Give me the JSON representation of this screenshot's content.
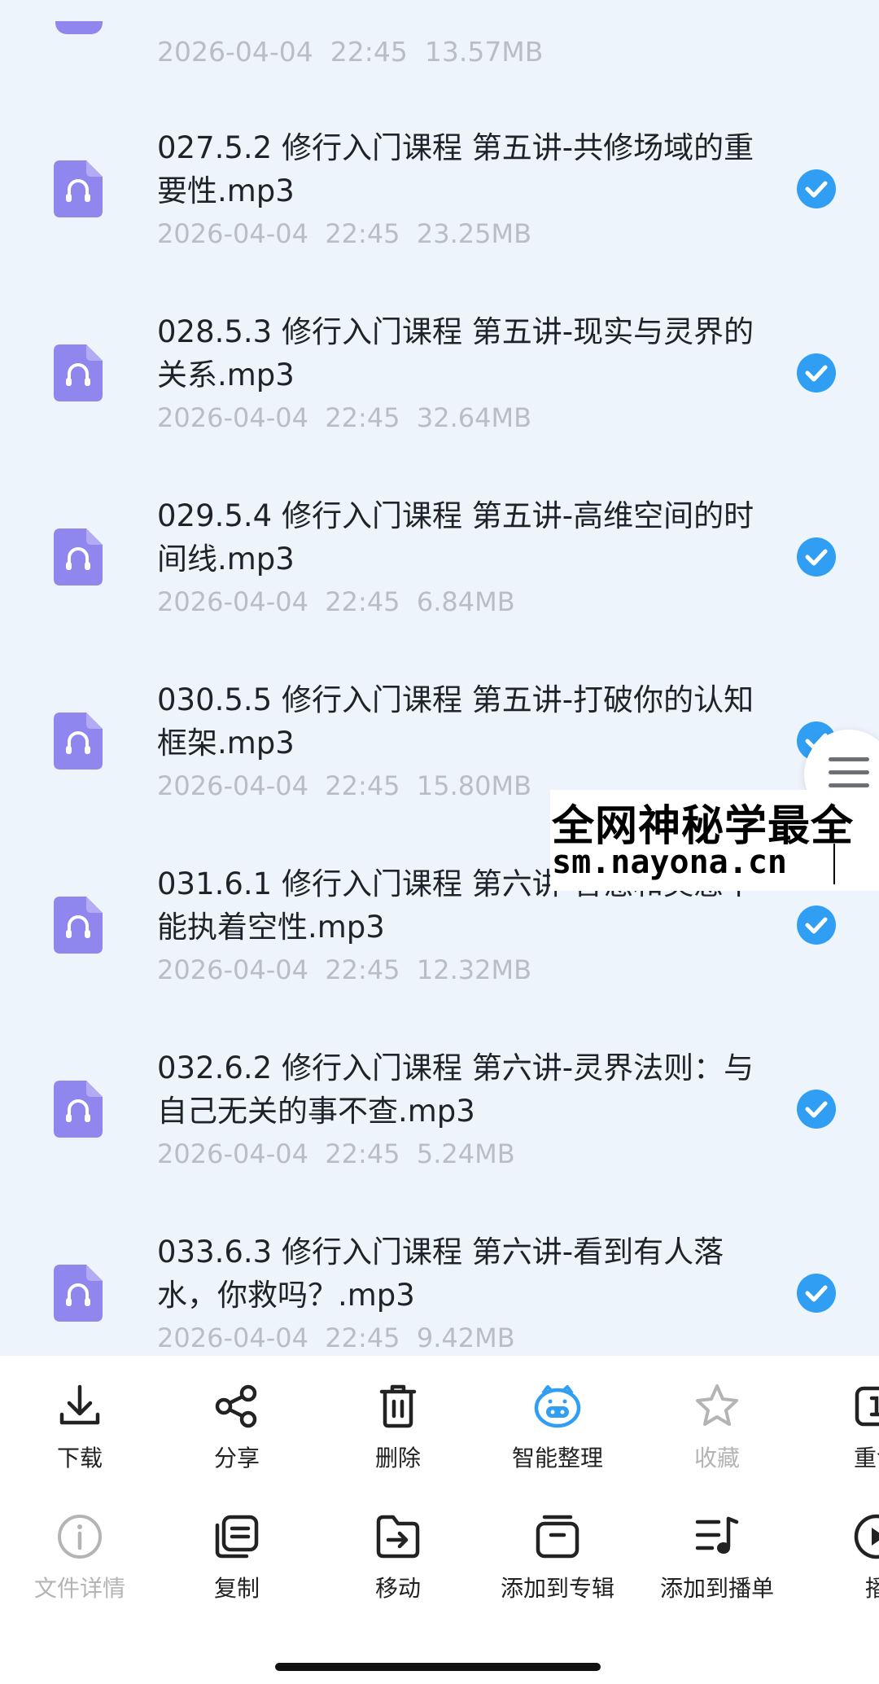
{
  "file_list": {
    "partial_top_meta": "2026-04-04  22:45  13.57MB",
    "items": [
      {
        "title": "027.5.2 修行入门课程 第五讲-共修场域的重要性.mp3",
        "date": "2026-04-04",
        "time": "22:45",
        "size": "23.25MB",
        "selected": true
      },
      {
        "title": "028.5.3 修行入门课程 第五讲-现实与灵界的关系.mp3",
        "date": "2026-04-04",
        "time": "22:45",
        "size": "32.64MB",
        "selected": true
      },
      {
        "title": "029.5.4 修行入门课程 第五讲-高维空间的时间线.mp3",
        "date": "2026-04-04",
        "time": "22:45",
        "size": "6.84MB",
        "selected": true
      },
      {
        "title": "030.5.5 修行入门课程 第五讲-打破你的认知框架.mp3",
        "date": "2026-04-04",
        "time": "22:45",
        "size": "15.80MB",
        "selected": true
      },
      {
        "title": "031.6.1 修行入门课程 第六讲-智慧和灵感不能执着空性.mp3",
        "date": "2026-04-04",
        "time": "22:45",
        "size": "12.32MB",
        "selected": true
      },
      {
        "title": "032.6.2 修行入门课程 第六讲-灵界法则：与自己无关的事不查.mp3",
        "date": "2026-04-04",
        "time": "22:45",
        "size": "5.24MB",
        "selected": true
      },
      {
        "title": "033.6.3 修行入门课程 第六讲-看到有人落水，你救吗？.mp3",
        "date": "2026-04-04",
        "time": "22:45",
        "size": "9.42MB",
        "selected": true
      }
    ]
  },
  "watermark": {
    "line1": "全网神秘学最全",
    "line2": "sm.nayona.cn"
  },
  "toolbar": {
    "row1": [
      {
        "label": "下载",
        "icon": "download-icon"
      },
      {
        "label": "分享",
        "icon": "share-icon"
      },
      {
        "label": "删除",
        "icon": "trash-icon"
      },
      {
        "label": "智能整理",
        "icon": "smart-organize-icon"
      },
      {
        "label": "收藏",
        "icon": "star-icon"
      },
      {
        "label": "重命",
        "icon": "rename-icon"
      }
    ],
    "row2": [
      {
        "label": "文件详情",
        "icon": "info-icon"
      },
      {
        "label": "复制",
        "icon": "copy-icon"
      },
      {
        "label": "移动",
        "icon": "move-icon"
      },
      {
        "label": "添加到专辑",
        "icon": "album-icon"
      },
      {
        "label": "添加到播单",
        "icon": "playlist-icon"
      },
      {
        "label": "播",
        "icon": "play-icon"
      }
    ]
  },
  "colors": {
    "background": "#eef4fb",
    "file_icon": "#8f86ee",
    "check": "#2f9ef3",
    "smart_organize": "#2f9ef3",
    "disabled": "#b4b4b4"
  }
}
